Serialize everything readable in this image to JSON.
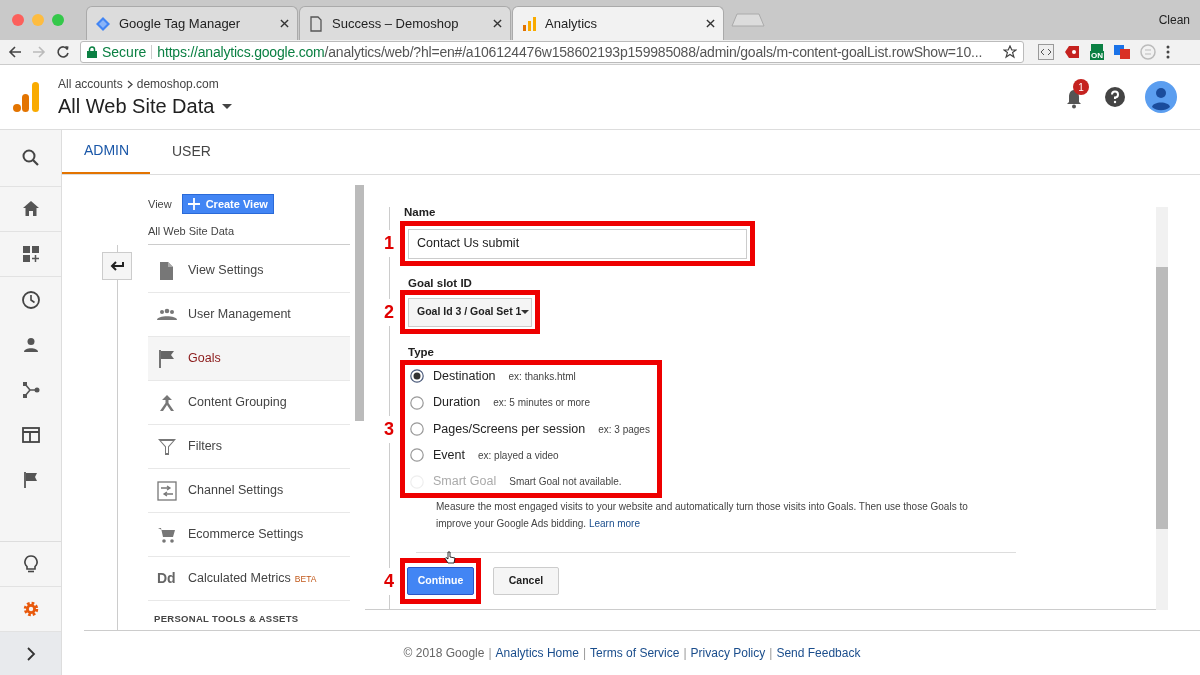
{
  "browser": {
    "tabs": [
      {
        "title": "Google Tag Manager",
        "selected": false
      },
      {
        "title": "Success – Demoshop",
        "selected": false
      },
      {
        "title": "Analytics",
        "selected": true
      }
    ],
    "profile": "Clean",
    "secure_label": "Secure",
    "url_host": "https://analytics.google.com",
    "url_path": "/analytics/web/?hl=en#/a106124476w158602193p159985088/admin/goals/m-content-goalList.rowShow=10...",
    "extension_badge": "ON"
  },
  "header": {
    "breadcrumb": [
      "All accounts",
      "demoshop.com"
    ],
    "view": "All Web Site Data",
    "notification_count": "1"
  },
  "rail": [
    {
      "selected": false
    },
    {
      "selected": false
    },
    {
      "selected": false
    },
    {
      "selected": false
    },
    {
      "selected": false
    },
    {
      "selected": false
    },
    {
      "selected": false
    },
    {
      "selected": false
    },
    {
      "selected": false
    },
    {
      "selected": true
    }
  ],
  "admin_tabs": [
    {
      "label": "ADMIN",
      "selected": true
    },
    {
      "label": "USER",
      "selected": false
    }
  ],
  "view_panel": {
    "label": "View",
    "create_button": "Create View",
    "view_name": "All Web Site Data",
    "items": [
      {
        "label": "View Settings",
        "selected": false
      },
      {
        "label": "User Management",
        "selected": false
      },
      {
        "label": "Goals",
        "selected": true
      },
      {
        "label": "Content Grouping",
        "selected": false
      },
      {
        "label": "Filters",
        "selected": false
      },
      {
        "label": "Channel Settings",
        "selected": false
      },
      {
        "label": "Ecommerce Settings",
        "selected": false
      },
      {
        "label": "Calculated Metrics",
        "glyph": "Dd",
        "badge": "BETA",
        "selected": false
      }
    ],
    "section_heading": "PERSONAL TOOLS & ASSETS"
  },
  "goal_form": {
    "name_label": "Name",
    "name_value": "Contact Us submit",
    "slot_label": "Goal slot ID",
    "slot_value": "Goal Id 3 / Goal Set 1",
    "type_label": "Type",
    "types": [
      {
        "label": "Destination",
        "example": "ex: thanks.html",
        "selected": true,
        "disabled": false
      },
      {
        "label": "Duration",
        "example": "ex: 5 minutes or more",
        "selected": false,
        "disabled": false
      },
      {
        "label": "Pages/Screens per session",
        "example": "ex: 3 pages",
        "selected": false,
        "disabled": false
      },
      {
        "label": "Event",
        "example": "ex: played a video",
        "selected": false,
        "disabled": false
      },
      {
        "label": "Smart Goal",
        "example": "Smart Goal not available.",
        "selected": false,
        "disabled": true
      }
    ],
    "smart_goal_description": "Measure the most engaged visits to your website and automatically turn those visits into Goals. Then use those Goals to improve your Google Ads bidding.",
    "learn_more": "Learn more",
    "continue": "Continue",
    "cancel": "Cancel"
  },
  "annotations": [
    "1",
    "2",
    "3",
    "4"
  ],
  "footer": {
    "copyright": "© 2018 Google",
    "separator": "|",
    "links": [
      "Analytics Home",
      "Terms of Service",
      "Privacy Policy",
      "Send Feedback"
    ]
  }
}
